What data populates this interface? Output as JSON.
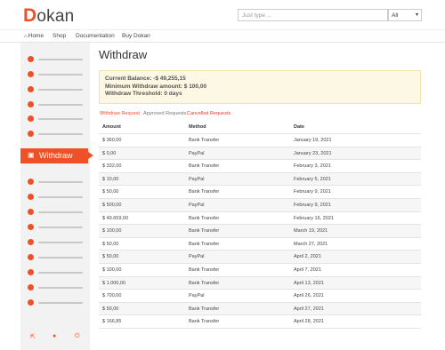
{
  "header": {
    "logo_letter": "D",
    "logo_rest": "okan",
    "search_placeholder": "Just type ...",
    "select_value": "All"
  },
  "nav": {
    "home": "Home",
    "shop": "Shop",
    "documentation": "Documentation",
    "buy": "Buy Dokan"
  },
  "sidebar": {
    "active_label": "Withdraw"
  },
  "page": {
    "title": "Withdraw",
    "balance": "Current Balance: -$ 49,255,15",
    "minimum": "Minimum Withdraw amount: $ 100,00",
    "threshold": "Withdraw Threshold: 0 days"
  },
  "tabs": {
    "withdraw_request": "Withdraw Request",
    "approved": "Approved Requests",
    "cancelled": "Cancelled Requests"
  },
  "table": {
    "headers": [
      "Amount",
      "Method",
      "Date"
    ],
    "rows": [
      [
        "$ 360,00",
        "Bank Transfer",
        "January 19, 2021"
      ],
      [
        "$ 0,00",
        "PayPal",
        "January 23, 2021"
      ],
      [
        "$ 332,00",
        "Bank Transfer",
        "February 3, 2021"
      ],
      [
        "$ 10,00",
        "PayPal",
        "February 5, 2021"
      ],
      [
        "$ 50,00",
        "Bank Transfer",
        "February 9, 2021"
      ],
      [
        "$ 500,00",
        "PayPal",
        "February 9, 2021"
      ],
      [
        "$ 49.659,00",
        "Bank Transfer",
        "February 16, 2021"
      ],
      [
        "$ 100,00",
        "Bank Transfer",
        "March 19, 2021"
      ],
      [
        "$ 50,00",
        "Bank Transfer",
        "March 27, 2021"
      ],
      [
        "$ 50,00",
        "PayPal",
        "April 2, 2021"
      ],
      [
        "$ 100,00",
        "Bank Transfer",
        "April 7, 2021"
      ],
      [
        "$ 1.000,00",
        "Bank Transfer",
        "April 13, 2021"
      ],
      [
        "$ 700,00",
        "PayPal",
        "April 26, 2021"
      ],
      [
        "$ 50,00",
        "Bank Transfer",
        "April 27, 2021"
      ],
      [
        "$ 166,85",
        "Bank Transfer",
        "April 28, 2021"
      ]
    ]
  },
  "icons": {
    "home": "house-icon",
    "withdraw": "wallet-icon",
    "external": "external-link-icon",
    "user": "user-icon",
    "logout": "power-icon"
  },
  "colors": {
    "accent": "#f05025",
    "notice_bg": "#fcf8e3",
    "sidebar_bg": "#f2f2f2"
  }
}
